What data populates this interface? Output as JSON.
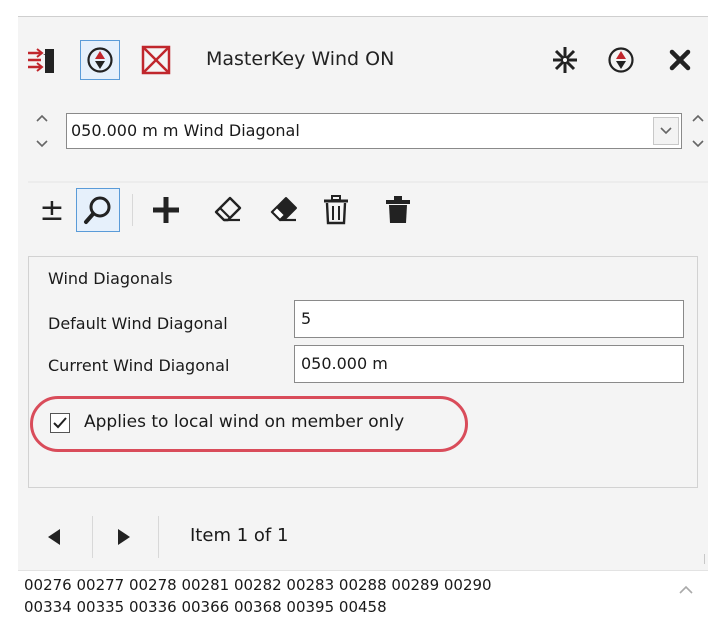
{
  "panel": {
    "title": "MasterKey Wind ON"
  },
  "header": {
    "icons": [
      "bar-pole-icon",
      "diagonal-target-icon",
      "cross-box-icon",
      "snowflake-pin-icon",
      "target-icon",
      "close-icon"
    ]
  },
  "selector": {
    "value": "050.000 m m Wind Diagonal"
  },
  "toolbar": {
    "plus_minus_label": "±",
    "tools": [
      "plus-minus-icon",
      "search-icon",
      "add-icon",
      "eraser-outline-icon",
      "eraser-filled-icon",
      "delete-outline-icon",
      "delete-filled-icon"
    ]
  },
  "wind_diagonals": {
    "group_label": "Wind Diagonals",
    "default_label": "Default Wind Diagonal",
    "default_value": "5",
    "current_label": "Current Wind Diagonal",
    "current_value": "050.000 m",
    "checkbox_label": "Applies to local wind on member only",
    "checkbox_checked": true
  },
  "navigator": {
    "item_text": "Item 1 of 1"
  },
  "members": {
    "line1": "00276 00277 00278 00281 00282 00283 00288 00289 00290",
    "line2": "00334 00335 00336 00366 00368 00395 00458"
  },
  "colors": {
    "accent_red": "#c0262c",
    "highlight_ring": "#d94c5a",
    "selected_border": "#5a9bd8"
  }
}
